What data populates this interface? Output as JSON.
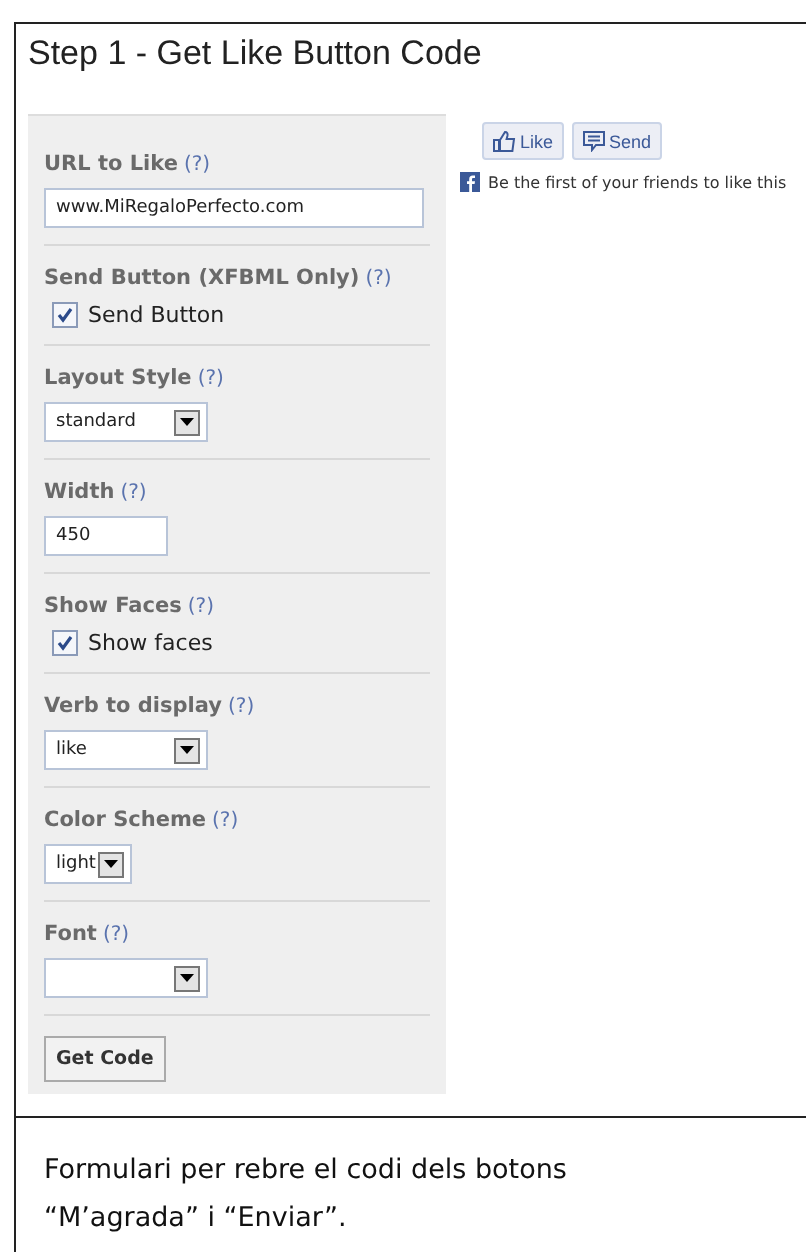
{
  "title": "Step 1 - Get Like Button Code",
  "fields": [
    {
      "kind": "text",
      "label": "URL to Like",
      "help": "(?)",
      "value": "www.MiRegaloPerfecto.com"
    },
    {
      "kind": "checkbox",
      "label": "Send Button (XFBML Only)",
      "help": "(?)",
      "option": "Send Button",
      "checked": true
    },
    {
      "kind": "select",
      "label": "Layout Style",
      "help": "(?)",
      "value": "standard"
    },
    {
      "kind": "text",
      "label": "Width",
      "help": "(?)",
      "value": "450"
    },
    {
      "kind": "checkbox",
      "label": "Show Faces",
      "help": "(?)",
      "option": "Show faces",
      "checked": true
    },
    {
      "kind": "select",
      "label": "Verb to display",
      "help": "(?)",
      "value": "like"
    },
    {
      "kind": "select",
      "label": "Color Scheme",
      "help": "(?)",
      "value": "light"
    },
    {
      "kind": "select",
      "label": "Font",
      "help": "(?)"
    }
  ],
  "submit": "Get Code",
  "preview": {
    "buttons": [
      {
        "kind": "like",
        "label": "Like"
      },
      {
        "kind": "send",
        "label": "Send"
      }
    ],
    "social_text": "Be the first of your friends to like this"
  },
  "caption": "Formulari per rebre el codi dels botons “M’agrada” i “Enviar”."
}
